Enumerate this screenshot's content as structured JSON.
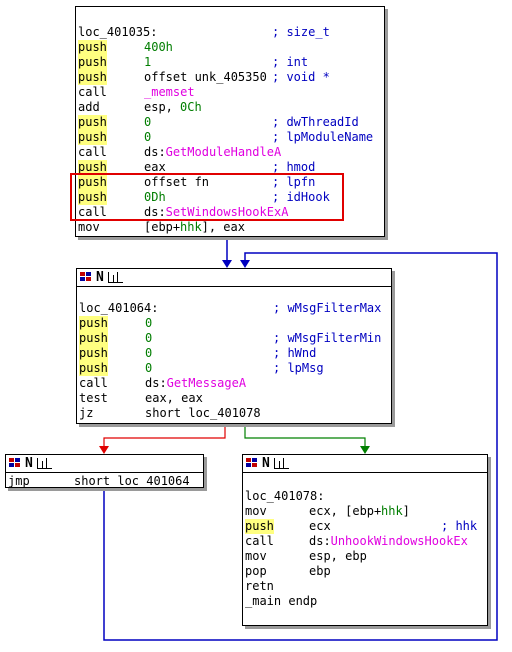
{
  "blocks": {
    "top": {
      "rows": [
        {
          "label": "loc_401035:",
          "comment": "; size_t"
        },
        {
          "mn": "push",
          "hl": true,
          "ops": [
            {
              "t": "400h",
              "c": "num"
            }
          ]
        },
        {
          "mn": "push",
          "hl": true,
          "ops": [
            {
              "t": "1",
              "c": "num"
            }
          ],
          "comment": "; int"
        },
        {
          "mn": "push",
          "hl": true,
          "ops": [
            {
              "t": "offset unk_405350",
              "c": "op1"
            }
          ],
          "comment": "; void *"
        },
        {
          "mn": "call",
          "hl": false,
          "ops": [
            {
              "t": "_memset",
              "c": "api"
            }
          ]
        },
        {
          "mn": "add",
          "hl": false,
          "ops": [
            {
              "t": "esp, ",
              "c": "op1"
            },
            {
              "t": "0Ch",
              "c": "num"
            }
          ]
        },
        {
          "mn": "push",
          "hl": true,
          "ops": [
            {
              "t": "0",
              "c": "num"
            }
          ],
          "comment": "; dwThreadId"
        },
        {
          "mn": "push",
          "hl": true,
          "ops": [
            {
              "t": "0",
              "c": "num"
            }
          ],
          "comment": "; lpModuleName"
        },
        {
          "mn": "call",
          "hl": false,
          "ops": [
            {
              "t": "ds:",
              "c": "op1"
            },
            {
              "t": "GetModuleHandleA",
              "c": "api"
            }
          ]
        },
        {
          "mn": "push",
          "hl": true,
          "ops": [
            {
              "t": "eax",
              "c": "op1"
            }
          ],
          "comment": "; hmod"
        },
        {
          "mn": "push",
          "hl": true,
          "ops": [
            {
              "t": "offset fn",
              "c": "op1"
            }
          ],
          "comment": "; lpfn"
        },
        {
          "mn": "push",
          "hl": true,
          "ops": [
            {
              "t": "0Dh",
              "c": "num"
            }
          ],
          "comment": "; idHook"
        },
        {
          "mn": "call",
          "hl": false,
          "ops": [
            {
              "t": "ds:",
              "c": "op1"
            },
            {
              "t": "SetWindowsHookExA",
              "c": "api"
            }
          ]
        },
        {
          "mn": "mov",
          "hl": false,
          "ops": [
            {
              "t": "[ebp+",
              "c": "op1"
            },
            {
              "t": "hhk",
              "c": "sym"
            },
            {
              "t": "], eax",
              "c": "op1"
            }
          ]
        }
      ]
    },
    "middle": {
      "title": "N",
      "rows": [
        {
          "label": "loc_401064:",
          "comment": "; wMsgFilterMax"
        },
        {
          "mn": "push",
          "hl": true,
          "ops": [
            {
              "t": "0",
              "c": "num"
            }
          ]
        },
        {
          "mn": "push",
          "hl": true,
          "ops": [
            {
              "t": "0",
              "c": "num"
            }
          ],
          "comment": "; wMsgFilterMin"
        },
        {
          "mn": "push",
          "hl": true,
          "ops": [
            {
              "t": "0",
              "c": "num"
            }
          ],
          "comment": "; hWnd"
        },
        {
          "mn": "push",
          "hl": true,
          "ops": [
            {
              "t": "0",
              "c": "num"
            }
          ],
          "comment": "; lpMsg"
        },
        {
          "mn": "call",
          "hl": false,
          "ops": [
            {
              "t": "ds:",
              "c": "op1"
            },
            {
              "t": "GetMessageA",
              "c": "api"
            }
          ]
        },
        {
          "mn": "test",
          "hl": false,
          "ops": [
            {
              "t": "eax, eax",
              "c": "op1"
            }
          ]
        },
        {
          "mn": "jz",
          "hl": false,
          "ops": [
            {
              "t": "short loc_401078",
              "c": "op1"
            }
          ]
        }
      ]
    },
    "left": {
      "title": "N",
      "rows": [
        {
          "mn": "jmp",
          "hl": false,
          "ops": [
            {
              "t": "short loc_401064",
              "c": "op1"
            }
          ]
        }
      ]
    },
    "right": {
      "title": "N",
      "rows": [
        {
          "label": "loc_401078:"
        },
        {
          "mn": "mov",
          "hl": false,
          "ops": [
            {
              "t": "ecx, [ebp+",
              "c": "op1"
            },
            {
              "t": "hhk",
              "c": "sym"
            },
            {
              "t": "]",
              "c": "op1"
            }
          ]
        },
        {
          "mn": "push",
          "hl": true,
          "ops": [
            {
              "t": "ecx",
              "c": "op1"
            }
          ],
          "comment": "; hhk"
        },
        {
          "mn": "call",
          "hl": false,
          "ops": [
            {
              "t": "ds:",
              "c": "op1"
            },
            {
              "t": "UnhookWindowsHookEx",
              "c": "api"
            }
          ]
        },
        {
          "mn": "mov",
          "hl": false,
          "ops": [
            {
              "t": "esp, ebp",
              "c": "op1"
            }
          ]
        },
        {
          "mn": "pop",
          "hl": false,
          "ops": [
            {
              "t": "ebp",
              "c": "op1"
            }
          ]
        },
        {
          "mn": "retn",
          "hl": false,
          "ops": []
        },
        {
          "label": "_main endp"
        }
      ]
    }
  },
  "colors": {
    "blue_edge": "#0000c0",
    "red_edge": "#e00000",
    "green_edge": "#008000",
    "highlight": "#ffff80",
    "api": "#e000e0"
  }
}
